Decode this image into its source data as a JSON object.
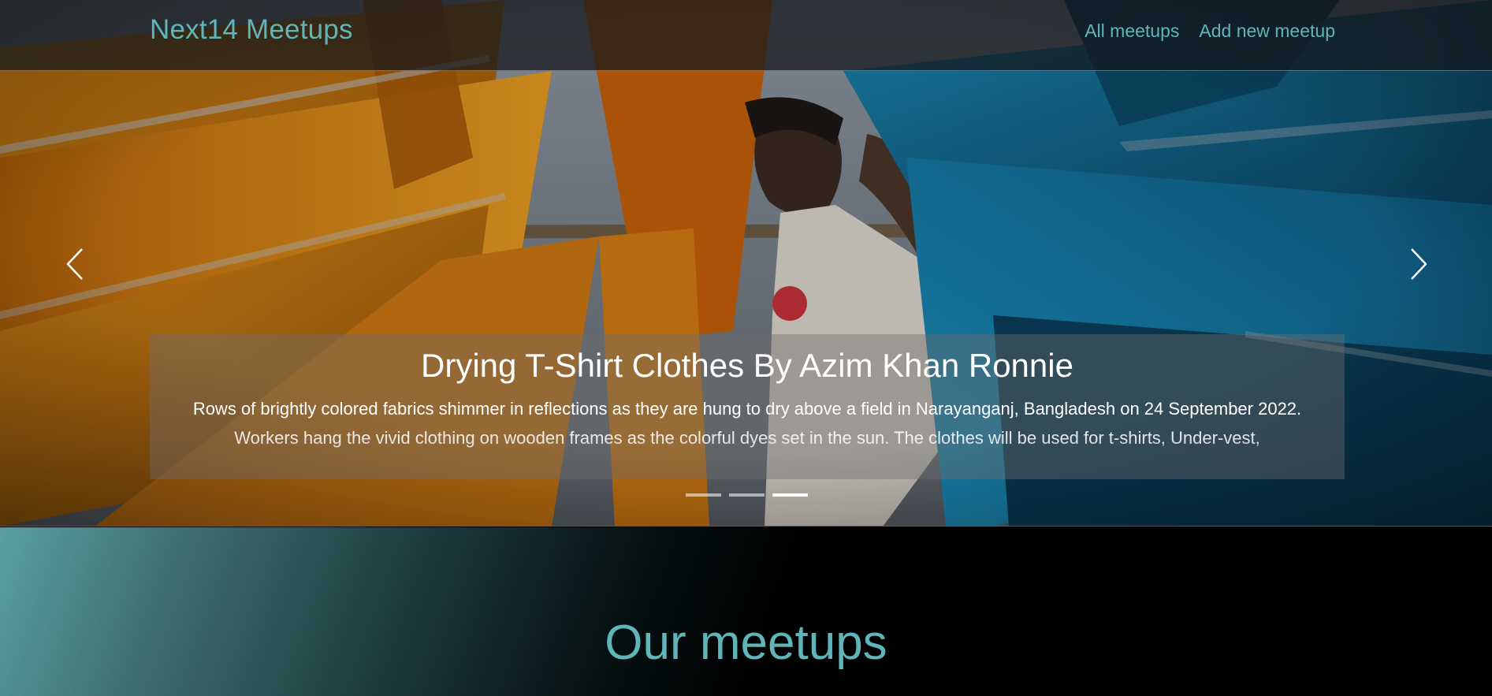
{
  "navbar": {
    "brand": "Next14 Meetups",
    "links": [
      {
        "label": "All meetups"
      },
      {
        "label": "Add new meetup"
      }
    ]
  },
  "carousel": {
    "slide_count": 3,
    "active_index": 2,
    "caption_title": "Drying T-Shirt Clothes By Azim Khan Ronnie",
    "caption_text": "Rows of brightly colored fabrics shimmer in reflections as they are hung to dry above a field in Narayanganj, Bangladesh on 24 September 2022. Workers hang the vivid clothing on wooden frames as the colorful dyes set in the sun. The clothes will be used for t-shirts, Under-vest,"
  },
  "section": {
    "title": "Our meetups"
  },
  "colors": {
    "accent": "#5fb5b8",
    "background": "#000000"
  }
}
